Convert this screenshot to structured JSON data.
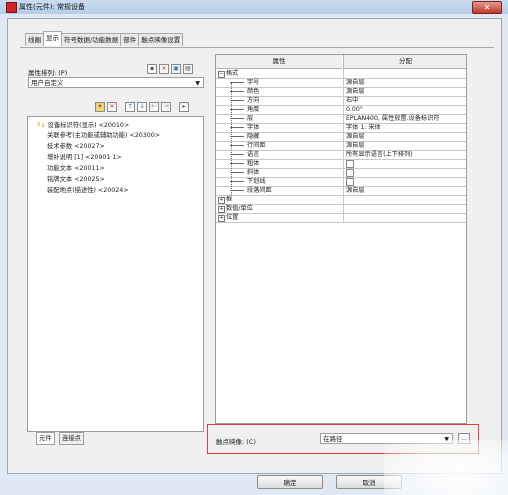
{
  "window": {
    "title": "属性(元件): 常规设备",
    "close_label": "✕"
  },
  "tabs": [
    "线圈",
    "显示",
    "符号数据/功能数据",
    "部件",
    "触点映像设置"
  ],
  "left": {
    "sort_label": "属性排列: (P)",
    "sort_value": "用户自定义",
    "items": [
      "设备标识符(显示) <20010>",
      "关联参考(主功能或辅助功能) <20300>",
      "技术参数 <20027>",
      "增补说明 [1] <20901 1>",
      "功能文本 <20011>",
      "铭牌文本 <20025>",
      "装配地点(描述性) <20024>"
    ],
    "bottom_tabs": [
      "元件",
      "连接点"
    ]
  },
  "grid": {
    "headers": [
      "属性",
      "分配"
    ],
    "rows": [
      {
        "name": "格式",
        "value": "",
        "type": "group"
      },
      {
        "name": "字号",
        "value": "源自层",
        "type": "text"
      },
      {
        "name": "颜色",
        "value": "源自层",
        "type": "text"
      },
      {
        "name": "方向",
        "value": "右中",
        "type": "text"
      },
      {
        "name": "角度",
        "value": "0.00°",
        "type": "text"
      },
      {
        "name": "层",
        "value": "EPLAN400, 属性放置.设备标识符",
        "type": "text"
      },
      {
        "name": "字体",
        "value": "字体 1: 宋体",
        "type": "text"
      },
      {
        "name": "隐藏",
        "value": "源自层",
        "type": "text"
      },
      {
        "name": "行间距",
        "value": "源自层",
        "type": "text"
      },
      {
        "name": "语言",
        "value": "所有显示语言(上下排列)",
        "type": "text"
      },
      {
        "name": "粗体",
        "value": "",
        "type": "check"
      },
      {
        "name": "斜体",
        "value": "",
        "type": "check"
      },
      {
        "name": "下划线",
        "value": "",
        "type": "check"
      },
      {
        "name": "段落间距",
        "value": "源自层",
        "type": "text"
      },
      {
        "name": "框",
        "value": "",
        "type": "group"
      },
      {
        "name": "数值/单位",
        "value": "",
        "type": "group"
      },
      {
        "name": "位置",
        "value": "",
        "type": "group"
      }
    ]
  },
  "contact": {
    "label": "触点映像: (C)",
    "value": "在路径",
    "more": "..."
  },
  "buttons": {
    "ok": "确定",
    "cancel": "取消"
  },
  "colors": {
    "highlight": "#e04040",
    "app_icon": "#d0262b"
  }
}
